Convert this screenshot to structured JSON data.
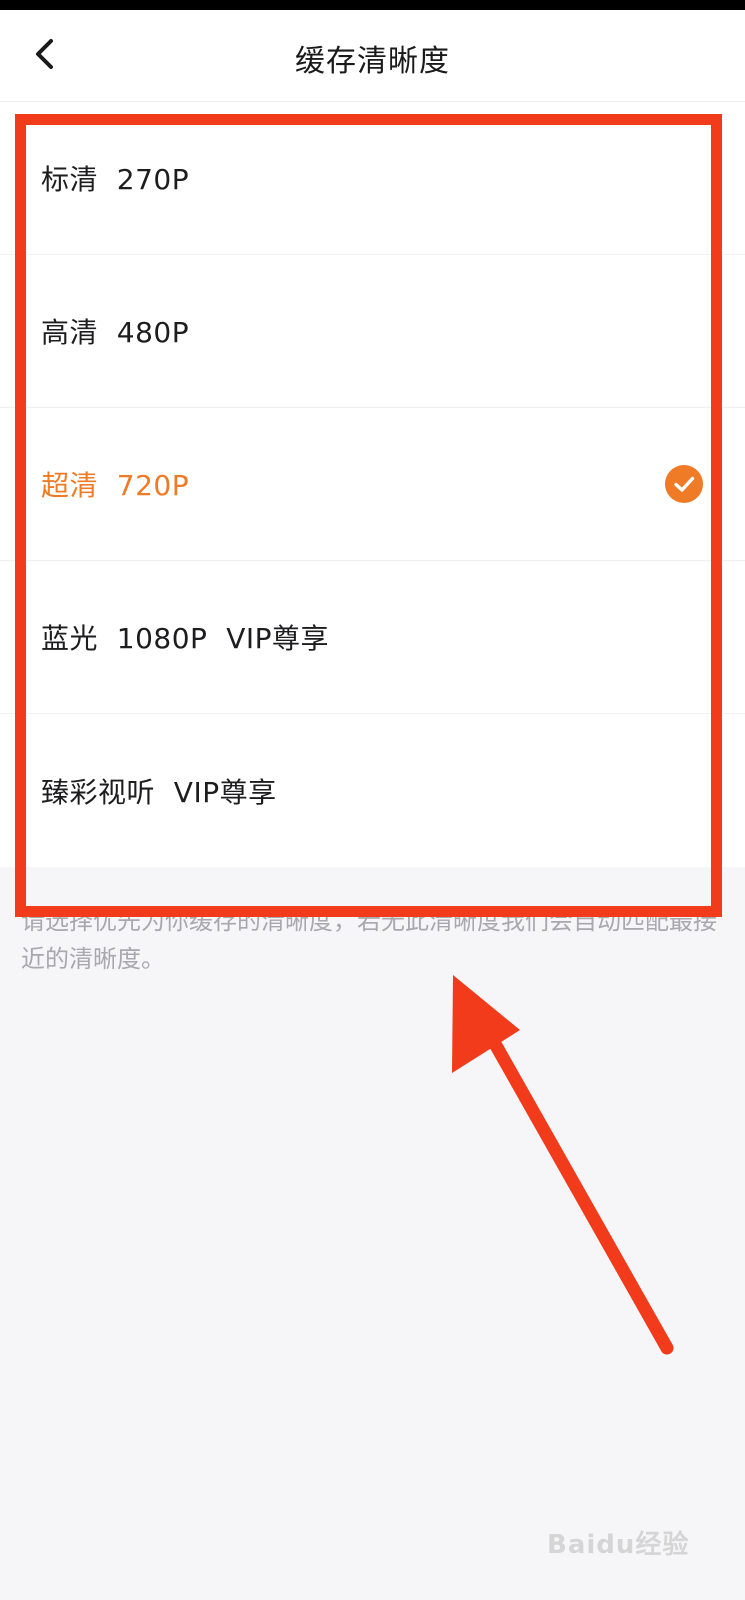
{
  "header": {
    "title": "缓存清晰度",
    "back_icon": "chevron-left-icon"
  },
  "options": [
    {
      "label": "标清  270P",
      "selected": false
    },
    {
      "label": "高清  480P",
      "selected": false
    },
    {
      "label": "超清  720P",
      "selected": true
    },
    {
      "label": "蓝光  1080P  VIP尊享",
      "selected": false
    },
    {
      "label": "臻彩视听  VIP尊享",
      "selected": false
    }
  ],
  "hint": "请选择优先为你缓存的清晰度，若无此清晰度我们会自动匹配最接近的清晰度。",
  "colors": {
    "accent": "#ef7b26",
    "annotation": "#f23b1b",
    "check_icon": "check-circle-icon"
  },
  "watermark": "Baidu经验"
}
